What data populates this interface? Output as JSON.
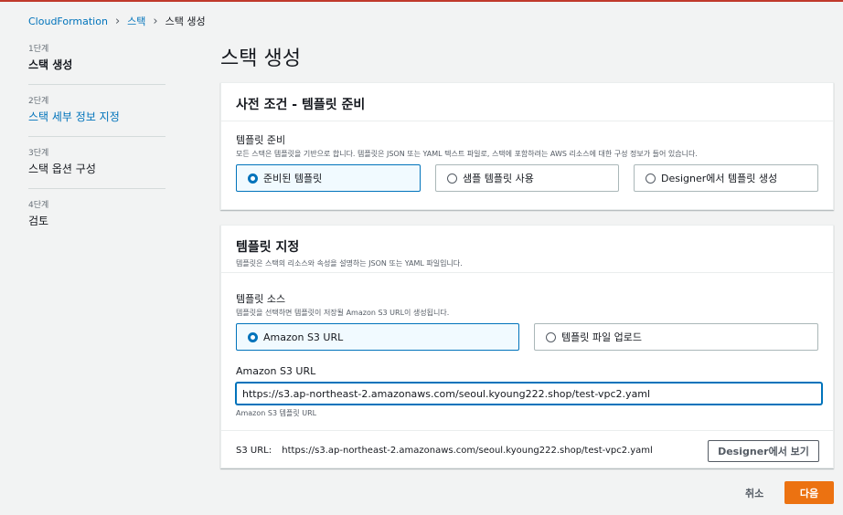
{
  "breadcrumb": {
    "items": [
      "CloudFormation",
      "스택",
      "스택 생성"
    ]
  },
  "steps": [
    {
      "num": "1단계",
      "label": "스택 생성"
    },
    {
      "num": "2단계",
      "label": "스택 세부 정보 지정"
    },
    {
      "num": "3단계",
      "label": "스택 옵션 구성"
    },
    {
      "num": "4단계",
      "label": "검토"
    }
  ],
  "page_title": "스택 생성",
  "prereq": {
    "title": "사전 조건 - 템플릿 준비",
    "field_label": "템플릿 준비",
    "field_desc": "모든 스택은 템플릿을 기반으로 합니다. 템플릿은 JSON 또는 YAML 텍스트 파일로, 스택에 포함하려는 AWS 리소스에 대한 구성 정보가 들어 있습니다.",
    "options": [
      "준비된 템플릿",
      "샘플 템플릿 사용",
      "Designer에서 템플릿 생성"
    ],
    "selected": "준비된 템플릿"
  },
  "specify": {
    "title": "템플릿 지정",
    "desc": "템플릿은 스택의 리소스와 속성을 설명하는 JSON 또는 YAML 파일입니다.",
    "source_label": "템플릿 소스",
    "source_desc": "템플릿을 선택하면 템플릿이 저장될 Amazon S3 URL이 생성됩니다.",
    "source_options": [
      "Amazon S3 URL",
      "템플릿 파일 업로드"
    ],
    "source_selected": "Amazon S3 URL",
    "url_label": "Amazon S3 URL",
    "url_value": "https://s3.ap-northeast-2.amazonaws.com/seoul.kyoung222.shop/test-vpc2.yaml",
    "url_hint": "Amazon S3 템플릿 URL",
    "s3_url_label": "S3 URL:",
    "s3_url_value": "https://s3.ap-northeast-2.amazonaws.com/seoul.kyoung222.shop/test-vpc2.yaml",
    "designer_button": "Designer에서 보기"
  },
  "actions": {
    "cancel": "취소",
    "next": "다음"
  },
  "colors": {
    "link": "#0073bb",
    "primary": "#ec7211",
    "background": "#f2f3f3"
  }
}
